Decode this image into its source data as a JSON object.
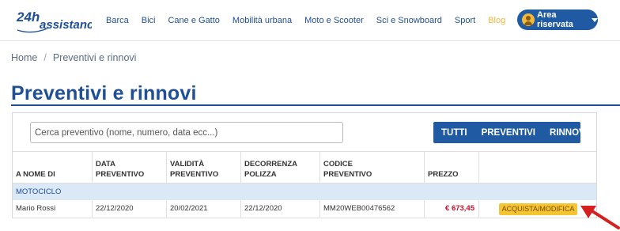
{
  "header": {
    "logo_text": "24h assistance",
    "nav": [
      "Barca",
      "Bici",
      "Cane e Gatto",
      "Mobilità urbana",
      "Moto e Scooter",
      "Sci e Snowboard",
      "Sport",
      "Blog"
    ],
    "area_label": "Area riservata"
  },
  "breadcrumb": {
    "home": "Home",
    "separator": "/",
    "current": "Preventivi e rinnovi"
  },
  "page": {
    "title": "Preventivi e rinnovi"
  },
  "search": {
    "placeholder": "Cerca preventivo (nome, numero, data ecc...)"
  },
  "filters": [
    "TUTTI",
    "PREVENTIVI",
    "RINNOVI"
  ],
  "table": {
    "headers": [
      "A NOME DI",
      "DATA PREVENTIVO",
      "VALIDITÀ PREVENTIVO",
      "DECORRENZA POLIZZA",
      "CODICE PREVENTIVO",
      "PREZZO",
      ""
    ],
    "header_lines": [
      [
        "A NOME DI"
      ],
      [
        "DATA",
        "PREVENTIVO"
      ],
      [
        "VALIDITÀ",
        "PREVENTIVO"
      ],
      [
        "DECORRENZA",
        "POLIZZA"
      ],
      [
        "CODICE",
        "PREVENTIVO"
      ],
      [
        "PREZZO"
      ],
      [
        ""
      ]
    ],
    "group": "MOTOCICLO",
    "rows": [
      {
        "name": "Mario Rossi",
        "data_preventivo": "22/12/2020",
        "validita": "20/02/2021",
        "decorrenza": "22/12/2020",
        "codice": "MM20WEB00476562",
        "prezzo": "€ 673,45",
        "action": "ACQUISTA/MODIFICA"
      }
    ]
  },
  "colors": {
    "brand_blue": "#1f4f95",
    "button_blue": "#1f5aa3",
    "accent_yellow": "#f5c531",
    "price_red": "#c8102e",
    "arrow_red": "#d62020"
  }
}
